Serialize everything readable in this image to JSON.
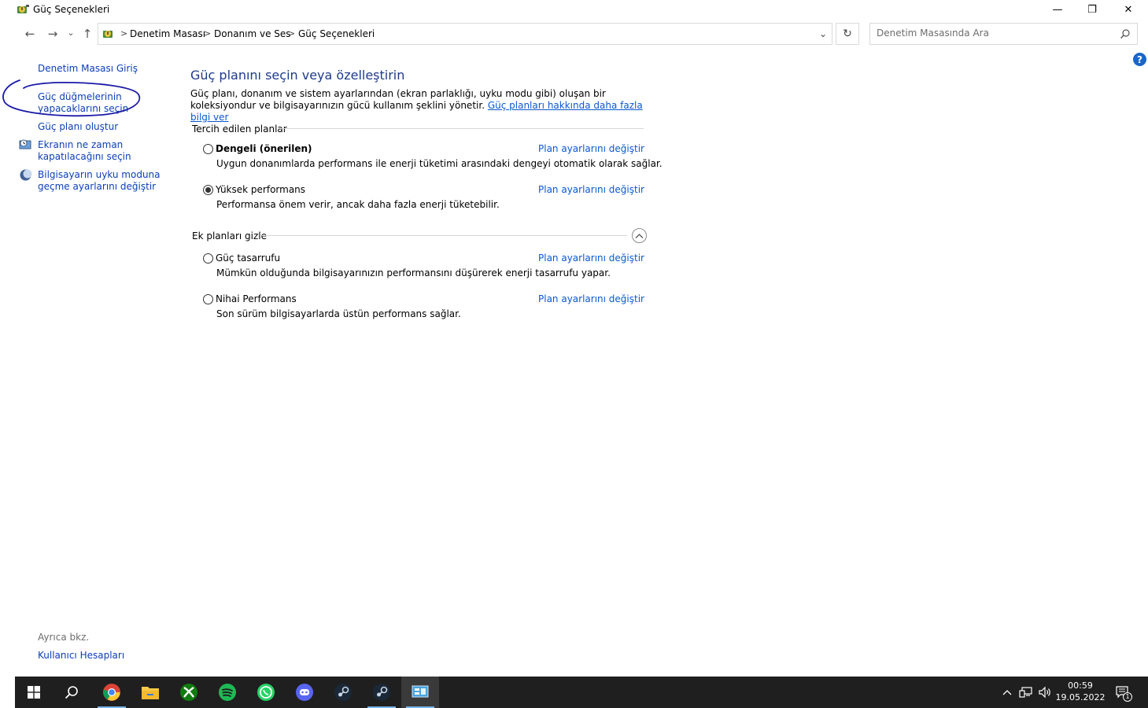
{
  "window": {
    "title": "Güç Seçenekleri",
    "minimize": "—",
    "restore": "❐",
    "close": "✕"
  },
  "nav": {
    "back": "←",
    "forward": "→",
    "recent": "⌄",
    "up": "↑",
    "breadcrumbs": [
      "Denetim Masası",
      "Donanım ve Ses",
      "Güç Seçenekleri"
    ],
    "separator": ">",
    "dropdown": "⌄",
    "refresh": "↻",
    "search_placeholder": "Denetim Masasında Ara"
  },
  "left_pane": {
    "home": "Denetim Masası Giriş",
    "power_buttons_line1": "Güç düğmelerinin",
    "power_buttons_line2": "yapacaklarını seçin",
    "create_plan": "Güç planı oluştur",
    "display_off_line1": "Ekranın ne zaman",
    "display_off_line2": "kapatılacağını seçin",
    "sleep_line1": "Bilgisayarın uyku moduna",
    "sleep_line2": "geçme ayarlarını değiştir",
    "see_also": "Ayrıca bkz.",
    "user_accounts": "Kullanıcı Hesapları"
  },
  "help": "?",
  "main": {
    "heading": "Güç planını seçin veya özelleştirin",
    "description": "Güç planı, donanım ve sistem ayarlarından (ekran parlaklığı, uyku modu gibi) oluşan bir koleksiyondur ve bilgisayarınızın gücü kullanım şeklini yönetir. ",
    "description_link": "Güç planları hakkında daha fazla bilgi ver",
    "preferred_header": "Tercih edilen planlar",
    "additional_header": "Ek planları gizle",
    "change_link": "Plan ayarlarını değiştir",
    "plans": [
      {
        "name": "Dengeli (önerilen)",
        "desc": "Uygun donanımlarda performans ile enerji tüketimi arasındaki dengeyi otomatik olarak sağlar.",
        "selected": false
      },
      {
        "name": "Yüksek performans",
        "desc": "Performansa önem verir, ancak daha fazla enerji tüketebilir.",
        "selected": true
      },
      {
        "name": "Güç tasarrufu",
        "desc": "Mümkün olduğunda bilgisayarınızın performansını düşürerek enerji tasarrufu yapar.",
        "selected": false
      },
      {
        "name": "Nihai Performans",
        "desc": "Son sürüm bilgisayarlarda üstün performans sağlar.",
        "selected": false
      }
    ]
  },
  "taskbar": {
    "apps": [
      "start",
      "search",
      "chrome",
      "file-explorer",
      "xbox",
      "spotify",
      "whatsapp",
      "discord",
      "steam",
      "steam",
      "control-panel"
    ],
    "time": "00:59",
    "date": "19.05.2022",
    "notification_count": "1"
  },
  "colors": {
    "link": "#0b57d0",
    "left_link": "#0b3eb8",
    "heading": "#1e3a8c",
    "taskbar": "#1f1f1f",
    "annotation": "#1a1aa8"
  }
}
